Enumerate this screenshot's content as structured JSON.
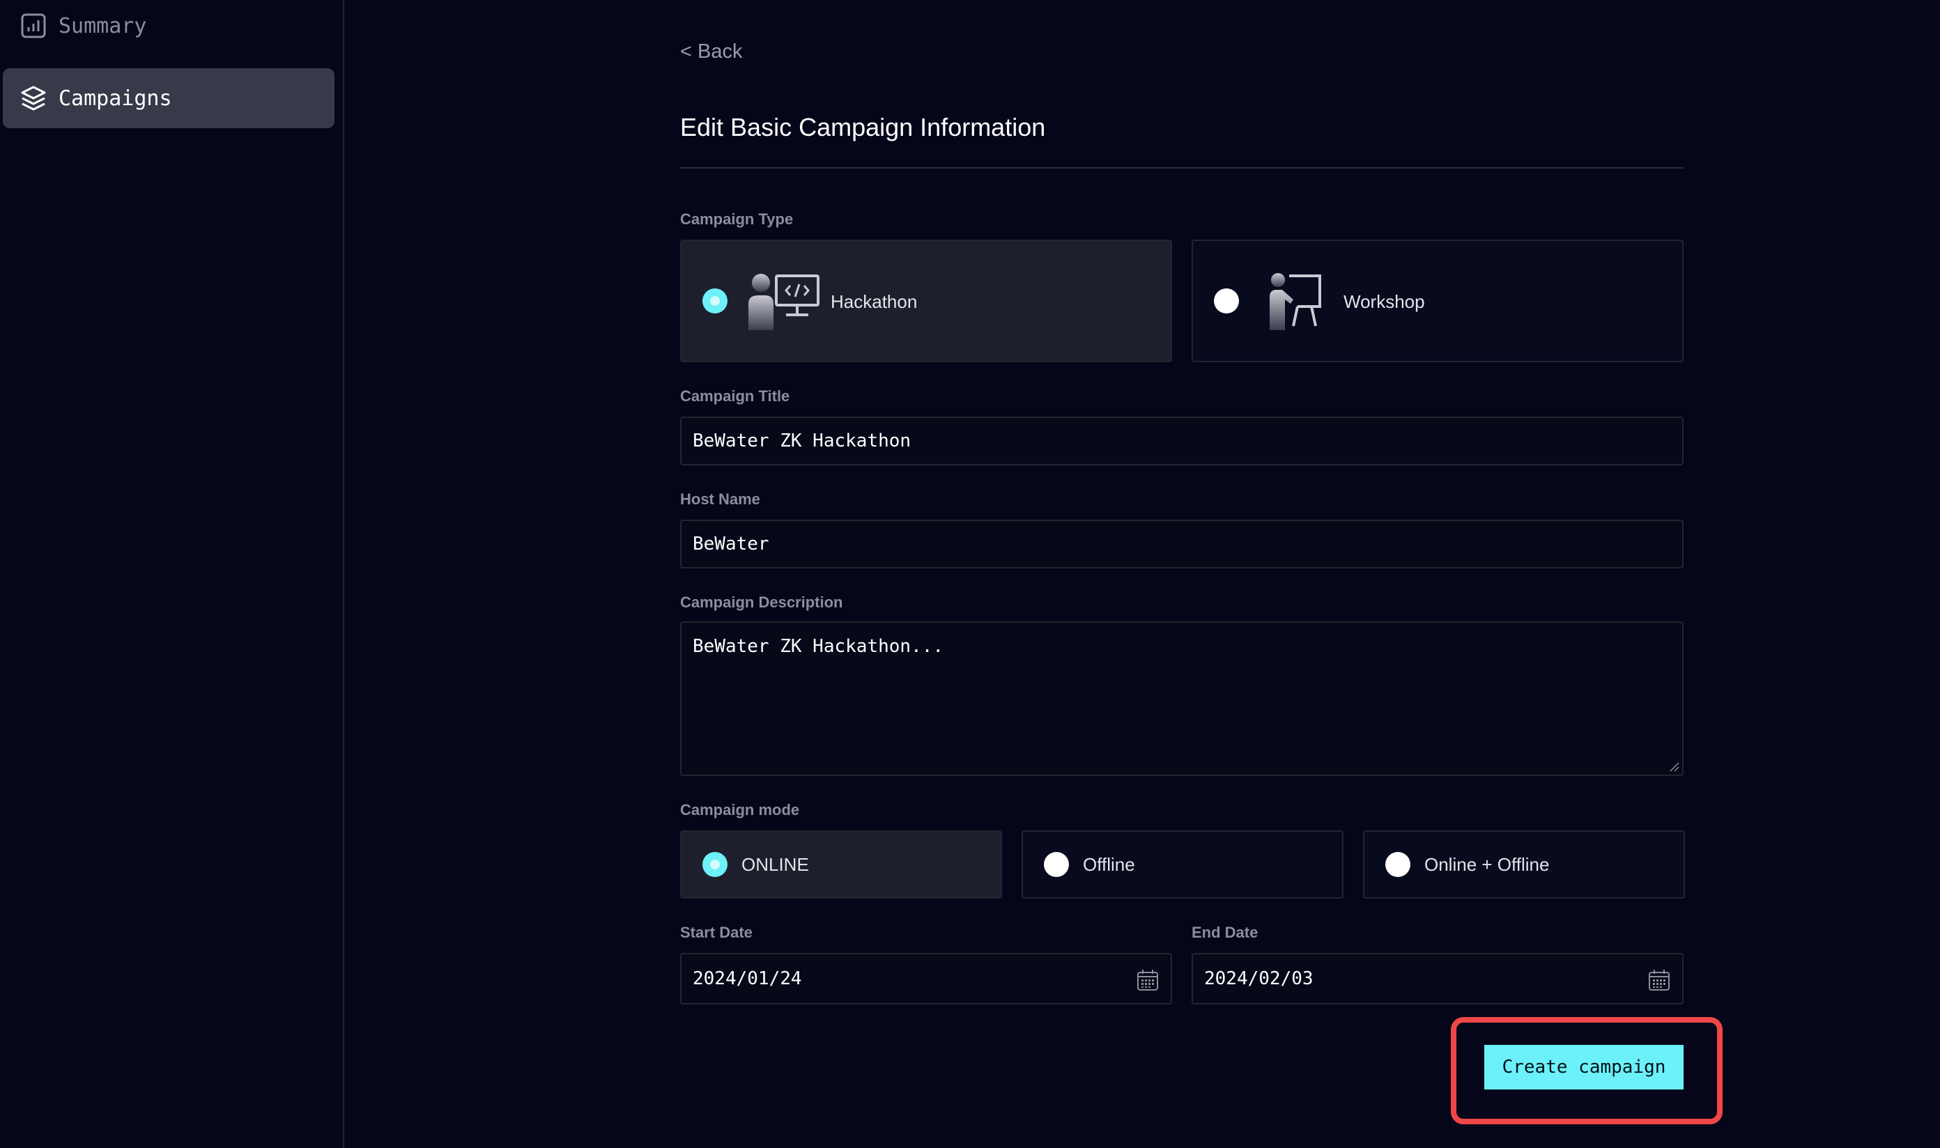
{
  "sidebar": {
    "items": [
      {
        "label": "Summary",
        "icon": "bar-chart-icon",
        "active": false
      },
      {
        "label": "Campaigns",
        "icon": "layers-icon",
        "active": true
      }
    ]
  },
  "header": {
    "back_label": "< Back",
    "title": "Edit Basic Campaign Information"
  },
  "form": {
    "campaign_type": {
      "label": "Campaign Type",
      "options": [
        {
          "label": "Hackathon",
          "icon": "hackathon-icon",
          "selected": true
        },
        {
          "label": "Workshop",
          "icon": "workshop-icon",
          "selected": false
        }
      ]
    },
    "campaign_title": {
      "label": "Campaign Title",
      "value": "BeWater ZK Hackathon"
    },
    "host_name": {
      "label": "Host Name",
      "value": "BeWater"
    },
    "campaign_description": {
      "label": "Campaign Description",
      "value": "BeWater ZK Hackathon..."
    },
    "campaign_mode": {
      "label": "Campaign mode",
      "options": [
        {
          "label": "ONLINE",
          "selected": true
        },
        {
          "label": "Offline",
          "selected": false
        },
        {
          "label": "Online + Offline",
          "selected": false
        }
      ]
    },
    "start_date": {
      "label": "Start Date",
      "value": "2024/01/24"
    },
    "end_date": {
      "label": "End Date",
      "value": "2024/02/03"
    },
    "submit_label": "Create campaign"
  },
  "colors": {
    "background": "#05061a",
    "accent": "#6cf0f9",
    "highlight": "#ef4747"
  }
}
